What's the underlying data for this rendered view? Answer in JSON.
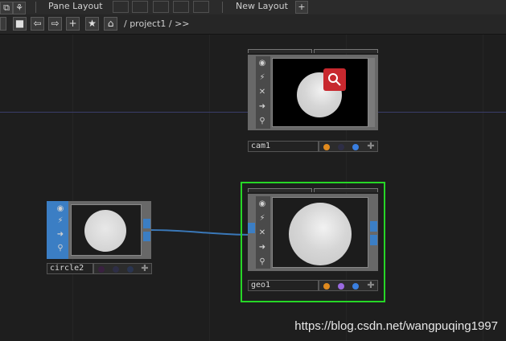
{
  "toolbar": {
    "pane_layout_label": "Pane Layout",
    "new_layout_label": "New Layout",
    "add_label": "+"
  },
  "nav": {
    "breadcrumb": "/ project1 / >>",
    "plus_label": "+",
    "star_label": "★"
  },
  "nodes": {
    "cam1": {
      "name": "cam1",
      "flags": [
        "#e08a1e",
        "#2e2e46",
        "#3a7fe0"
      ]
    },
    "circle2": {
      "name": "circle2",
      "flags": [
        "#3a2040",
        "#2e2e46",
        "#2a3550"
      ]
    },
    "geo1": {
      "name": "geo1",
      "flags": [
        "#e08a1e",
        "#9a6ae0",
        "#3a7fe0"
      ]
    }
  },
  "colors": {
    "selected_border": "#26d626",
    "connector": "#3a78b8",
    "magnifier_badge": "#c8282e"
  },
  "watermark": "https://blog.csdn.net/wangpuqing1997"
}
